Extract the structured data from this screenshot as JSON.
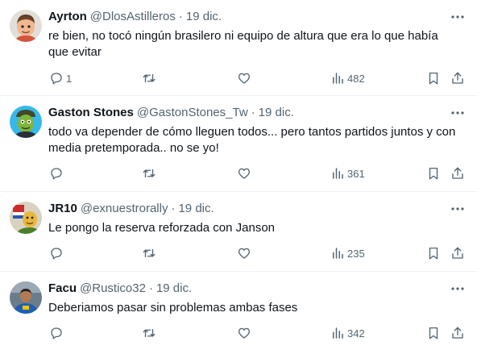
{
  "more_glyph": "···",
  "tweets": [
    {
      "name": "Ayrton",
      "handle": "@DlosAstilleros",
      "sep": "·",
      "date": "19 dic.",
      "text": "re bien, no tocó ningún brasilero ni equipo de altura que era lo que había que evitar",
      "replies": "1",
      "views": "482",
      "avatar": "memoji-icon"
    },
    {
      "name": "Gaston Stones",
      "handle": "@GastonStones_Tw",
      "sep": "·",
      "date": "19 dic.",
      "text": "todo va depender de cómo lleguen todos... pero tantos partidos juntos y con media pretemporada.. no se yo!",
      "replies": "",
      "views": "361",
      "avatar": "cartoon-character-icon"
    },
    {
      "name": "JR10",
      "handle": "@exnuestrorally",
      "sep": "·",
      "date": "19 dic.",
      "text": "Le pongo la reserva reforzada con Janson",
      "replies": "",
      "views": "235",
      "avatar": "flag-character-icon"
    },
    {
      "name": "Facu",
      "handle": "@Rustico32",
      "sep": "·",
      "date": "19 dic.",
      "text": "Deberiamos pasar sin problemas ambas fases",
      "replies": "",
      "views": "342",
      "avatar": "photo-avatar-icon"
    }
  ]
}
